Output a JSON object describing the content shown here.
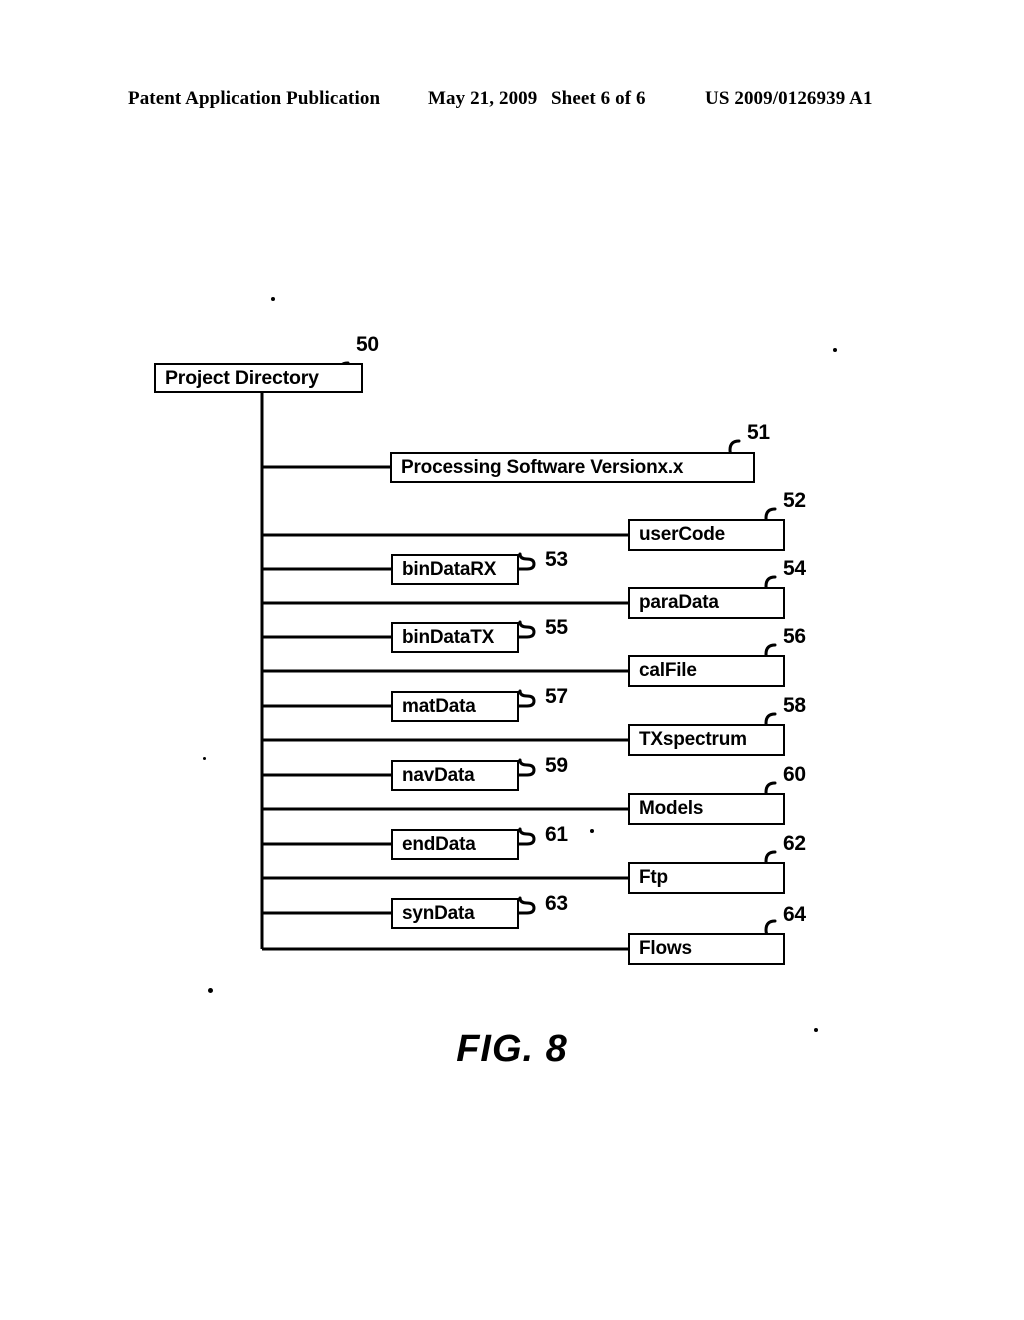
{
  "header": {
    "publication": "Patent Application Publication",
    "date": "May 21, 2009",
    "sheet": "Sheet 6 of 6",
    "patent_number": "US 2009/0126939 A1"
  },
  "figure": {
    "caption": "FIG. 8",
    "type": "tree-diagram",
    "root": {
      "label": "Project Directory",
      "ref": "50"
    },
    "nodes": [
      {
        "label": "Processing Software Versionx.x",
        "ref": "51",
        "column": "wide"
      },
      {
        "label": "userCode",
        "ref": "52",
        "column": "right"
      },
      {
        "label": "binDataRX",
        "ref": "53",
        "column": "left"
      },
      {
        "label": "paraData",
        "ref": "54",
        "column": "right"
      },
      {
        "label": "binDataTX",
        "ref": "55",
        "column": "left"
      },
      {
        "label": "calFile",
        "ref": "56",
        "column": "right"
      },
      {
        "label": "matData",
        "ref": "57",
        "column": "left"
      },
      {
        "label": "TXspectrum",
        "ref": "58",
        "column": "right"
      },
      {
        "label": "navData",
        "ref": "59",
        "column": "left"
      },
      {
        "label": "Models",
        "ref": "60",
        "column": "right"
      },
      {
        "label": "endData",
        "ref": "61",
        "column": "left"
      },
      {
        "label": "Ftp",
        "ref": "62",
        "column": "right"
      },
      {
        "label": "synData",
        "ref": "63",
        "column": "left"
      },
      {
        "label": "Flows",
        "ref": "64",
        "column": "right"
      }
    ]
  }
}
